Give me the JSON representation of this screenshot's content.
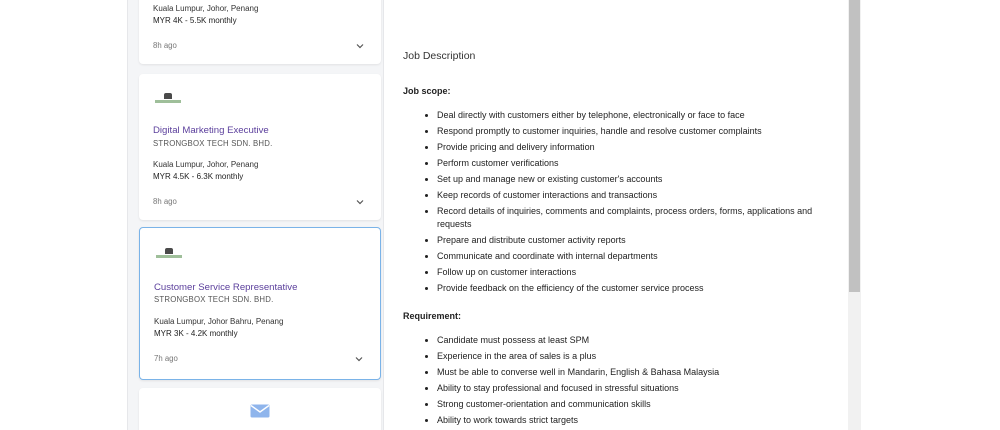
{
  "job_list": {
    "cards": [
      {
        "locations": "Kuala Lumpur, Johor, Penang",
        "salary": "MYR 4K - 5.5K monthly",
        "posted": "8h ago"
      },
      {
        "title": "Digital Marketing Executive",
        "company": "STRONGBOX TECH SDN. BHD.",
        "locations": "Kuala Lumpur, Johor, Penang",
        "salary": "MYR 4.5K - 6.3K monthly",
        "posted": "8h ago"
      },
      {
        "title": "Customer Service Representative",
        "company": "STRONGBOX TECH SDN. BHD.",
        "locations": "Kuala Lumpur, Johor Bahru, Penang",
        "salary": "MYR 3K - 4.2K monthly",
        "posted": "7h ago"
      }
    ]
  },
  "detail": {
    "heading": "Job Description",
    "scope_heading": "Job scope:",
    "scope_items": [
      "Deal directly with customers either by telephone, electronically or face to face",
      "Respond promptly to customer inquiries, handle and resolve customer complaints",
      "Provide pricing and delivery information",
      "Perform customer verifications",
      "Set up and manage new or existing customer's accounts",
      "Keep records of customer interactions and transactions",
      "Record details of inquiries, comments and complaints, process orders, forms, applications and requests",
      "Prepare and distribute customer activity reports",
      "Communicate and coordinate with internal departments",
      "Follow up on customer interactions",
      "Provide feedback on the efficiency of the customer service process"
    ],
    "requirement_heading": "Requirement:",
    "requirement_items": [
      "Candidate must possess at least SPM",
      "Experience in the area of sales is a plus",
      "Must be able to converse well in Mandarin, English & Bahasa Malaysia",
      "Ability to stay professional and focused in stressful situations",
      "Strong customer-orientation and communication skills",
      "Ability to work towards strict targets"
    ]
  },
  "colors": {
    "title_purple": "#5b3f9c",
    "selected_border": "#7ab3e8",
    "list_background": "#f4f5f7"
  },
  "icons": [
    "company-logo",
    "chevron-down-icon",
    "mail-icon"
  ]
}
